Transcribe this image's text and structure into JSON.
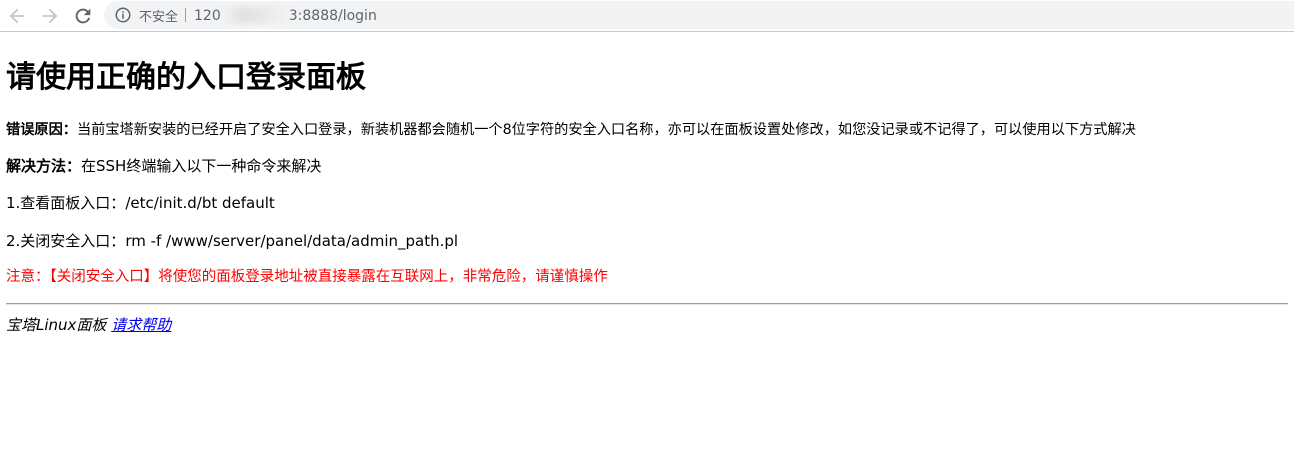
{
  "browser": {
    "security_label": "不安全",
    "url_prefix": "120",
    "url_suffix": "3:8888/login"
  },
  "page": {
    "heading": "请使用正确的入口登录面板",
    "reason": {
      "label": "错误原因：",
      "text": "当前宝塔新安装的已经开启了安全入口登录，新装机器都会随机一个8位字符的安全入口名称，亦可以在面板设置处修改，如您没记录或不记得了，可以使用以下方式解决"
    },
    "solution": {
      "label": "解决方法：",
      "text": "在SSH终端输入以下一种命令来解决"
    },
    "command1": {
      "label": "1.查看面板入口：",
      "command": "/etc/init.d/bt default"
    },
    "command2": {
      "label": "2.关闭安全入口：",
      "command": "rm -f /www/server/panel/data/admin_path.pl"
    },
    "warning": "注意：【关闭安全入口】将使您的面板登录地址被直接暴露在互联网上，非常危险，请谨慎操作",
    "footer": {
      "brand": "宝塔Linux面板",
      "help_link": "请求帮助"
    }
  },
  "colors": {
    "warning_text": "#ff0000",
    "link": "#0000ee",
    "omnibox_bg": "#f1f3f4"
  },
  "icons": [
    "back-arrow-icon",
    "forward-arrow-icon",
    "reload-icon",
    "info-icon"
  ]
}
